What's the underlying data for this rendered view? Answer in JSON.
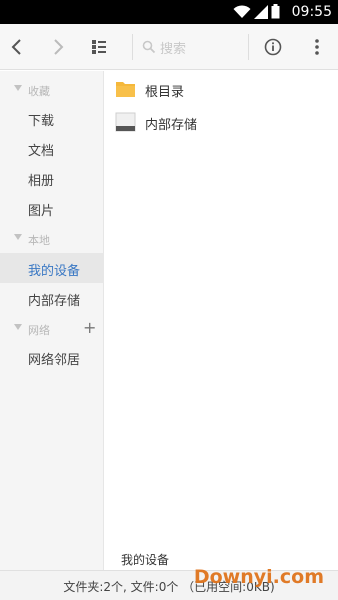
{
  "status_bar": {
    "time": "09:55"
  },
  "toolbar": {
    "search_placeholder": "搜索"
  },
  "sidebar": {
    "sections": [
      {
        "label": "收藏",
        "items": [
          "下载",
          "文档",
          "相册",
          "图片"
        ]
      },
      {
        "label": "本地",
        "items": [
          "我的设备",
          "内部存储"
        ]
      },
      {
        "label": "网络",
        "items": [
          "网络邻居"
        ]
      }
    ],
    "active_item": "我的设备"
  },
  "files": [
    {
      "name": "根目录",
      "icon": "folder-icon"
    },
    {
      "name": "内部存储",
      "icon": "storage-icon"
    }
  ],
  "current_path": "我的设备",
  "footer": {
    "summary": "文件夹:2个, 文件:0个  （已用空间:0KB)"
  },
  "watermark": "Downyi.com",
  "colors": {
    "accent": "#3a78c4",
    "folder": "#f5b83b",
    "watermark": "#e0741d"
  }
}
